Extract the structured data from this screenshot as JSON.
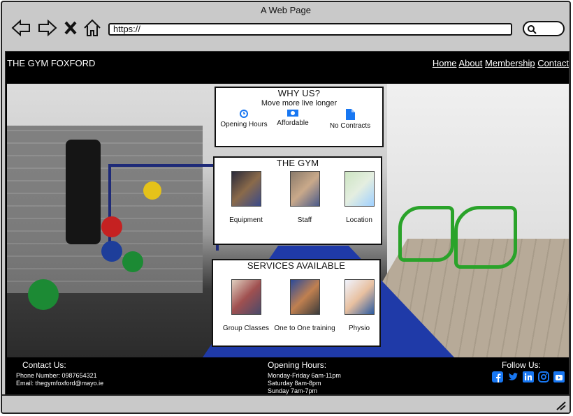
{
  "browser": {
    "title": "A Web Page",
    "url": "https://",
    "icons": [
      "back-arrow-icon",
      "forward-arrow-icon",
      "close-x-icon",
      "home-icon",
      "search-icon"
    ]
  },
  "site": {
    "brand": "THE GYM FOXFORD",
    "nav": [
      "Home",
      "About",
      "Membership",
      "Contact"
    ]
  },
  "why": {
    "title": "WHY US?",
    "subtitle": "Move more live longer",
    "features": [
      {
        "label": "Opening Hours",
        "icon": "clock-icon"
      },
      {
        "label": "Affordable",
        "icon": "money-icon"
      },
      {
        "label": "No Contracts",
        "icon": "document-icon"
      }
    ]
  },
  "gym": {
    "title": "THE GYM",
    "items": [
      {
        "label": "Equipment"
      },
      {
        "label": "Staff"
      },
      {
        "label": "Location"
      }
    ]
  },
  "services": {
    "title": "SERVICES AVAILABLE",
    "items": [
      {
        "label": "Group Classes"
      },
      {
        "label": "One to One training"
      },
      {
        "label": "Physio"
      }
    ]
  },
  "footer": {
    "contact_title": "Contact Us:",
    "phone": "Phone Number: 0987654321",
    "email": "Email: thegymfoxford@mayo.ie",
    "hours_title": "Opening Hours:",
    "hours": [
      "Monday-Friday 6am-11pm",
      "Saturday 8am-8pm",
      "Sunday 7am-7pm"
    ],
    "follow_title": "Follow Us:",
    "social": [
      "facebook-icon",
      "twitter-icon",
      "linkedin-icon",
      "instagram-icon",
      "youtube-icon"
    ],
    "social_color": "#1877f2"
  }
}
